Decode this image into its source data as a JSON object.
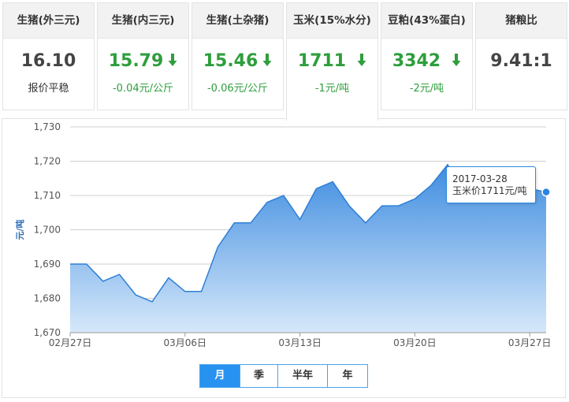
{
  "cards": [
    {
      "title": "生猪(外三元)",
      "value": "16.10",
      "sub": "报价平稳",
      "trend": "flat"
    },
    {
      "title": "生猪(内三元)",
      "value": "15.79",
      "sub": "-0.04元/公斤",
      "trend": "down"
    },
    {
      "title": "生猪(土杂猪)",
      "value": "15.46",
      "sub": "-0.06元/公斤",
      "trend": "down"
    },
    {
      "title": "玉米(15%水分)",
      "value": "1711",
      "sub": "-1元/吨",
      "trend": "down"
    },
    {
      "title": "豆粕(43%蛋白)",
      "value": "3342",
      "sub": "-2元/吨",
      "trend": "down"
    },
    {
      "title": "猪粮比",
      "value": "9.41:1",
      "sub": "",
      "trend": "flat"
    }
  ],
  "active_card": 3,
  "colors": {
    "down": "#2e9e3c",
    "accent": "#2892f0",
    "area_top": "#3f8de0",
    "area_bottom": "#d6e8fa"
  },
  "tooltip": {
    "date": "2017-03-28",
    "text": "玉米价1711元/吨"
  },
  "range_buttons": [
    "月",
    "季",
    "半年",
    "年"
  ],
  "active_range": 0,
  "chart_data": {
    "type": "area",
    "ylabel": "元/吨",
    "ylim": [
      1670,
      1730
    ],
    "yticks": [
      1670,
      1680,
      1690,
      1700,
      1710,
      1720,
      1730
    ],
    "ytick_labels": [
      "1,670",
      "1,680",
      "1,690",
      "1,700",
      "1,710",
      "1,720",
      "1,730"
    ],
    "xtick_labels": [
      "02月27日",
      "03月06日",
      "03月13日",
      "03月20日",
      "03月27日"
    ],
    "xtick_index": [
      0,
      7,
      14,
      21,
      28
    ],
    "grid": true,
    "series": [
      {
        "x": [
          "02-27",
          "02-28",
          "03-01",
          "03-02",
          "03-03",
          "03-04",
          "03-05",
          "03-06",
          "03-07",
          "03-08",
          "03-09",
          "03-10",
          "03-11",
          "03-12",
          "03-13",
          "03-14",
          "03-15",
          "03-16",
          "03-17",
          "03-18",
          "03-19",
          "03-20",
          "03-21",
          "03-22",
          "03-23",
          "03-24",
          "03-25",
          "03-26",
          "03-27",
          "03-28"
        ],
        "values": [
          1690,
          1690,
          1685,
          1687,
          1681,
          1679,
          1686,
          1682,
          1682,
          1695,
          1702,
          1702,
          1708,
          1710,
          1703,
          1712,
          1714,
          1707,
          1702,
          1707,
          1707,
          1709,
          1713,
          1719,
          1710,
          1712,
          1710,
          1712,
          1712,
          1711
        ]
      }
    ]
  }
}
